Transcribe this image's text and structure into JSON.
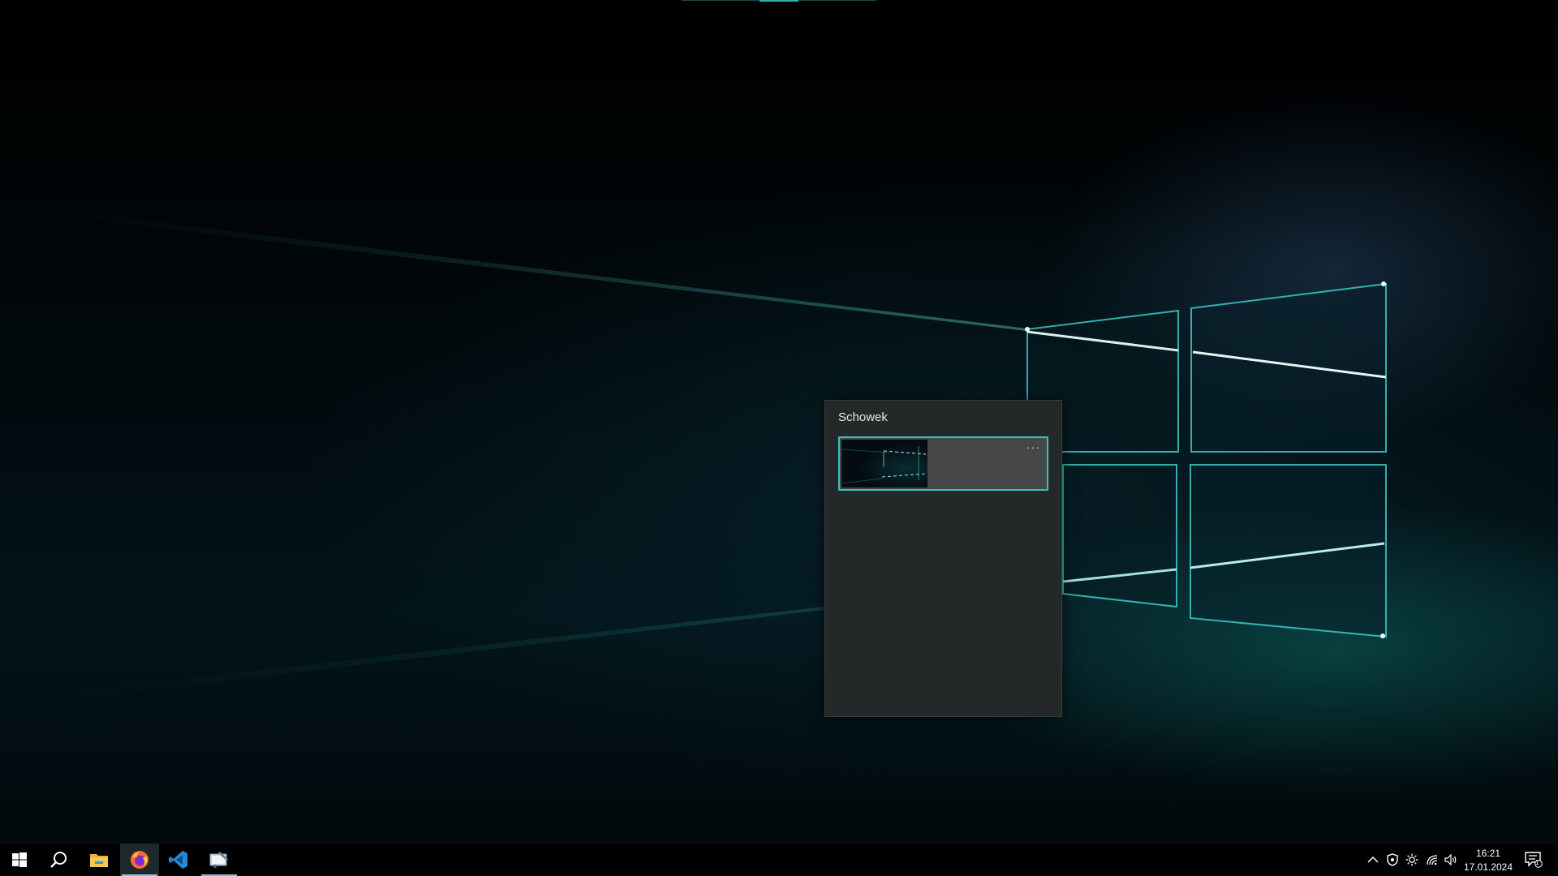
{
  "clipboard": {
    "title": "Schowek",
    "items": [
      {
        "type": "image",
        "more_label": "···"
      }
    ]
  },
  "taskbar": {
    "apps": [
      {
        "name": "Start",
        "icon": "windows-logo-icon"
      },
      {
        "name": "Search",
        "icon": "search-icon"
      },
      {
        "name": "File Explorer",
        "icon": "folder-icon"
      },
      {
        "name": "Firefox",
        "icon": "firefox-icon",
        "active": true
      },
      {
        "name": "Visual Studio Code",
        "icon": "vscode-icon"
      },
      {
        "name": "Snipping Tool",
        "icon": "snipping-tool-icon"
      }
    ],
    "tray": {
      "time": "16:21",
      "date": "17.01.2024",
      "notification_count": "1"
    }
  },
  "colors": {
    "accent": "#2fc3c3",
    "panel_bg": "#252829",
    "taskbar_bg": "#000000"
  }
}
